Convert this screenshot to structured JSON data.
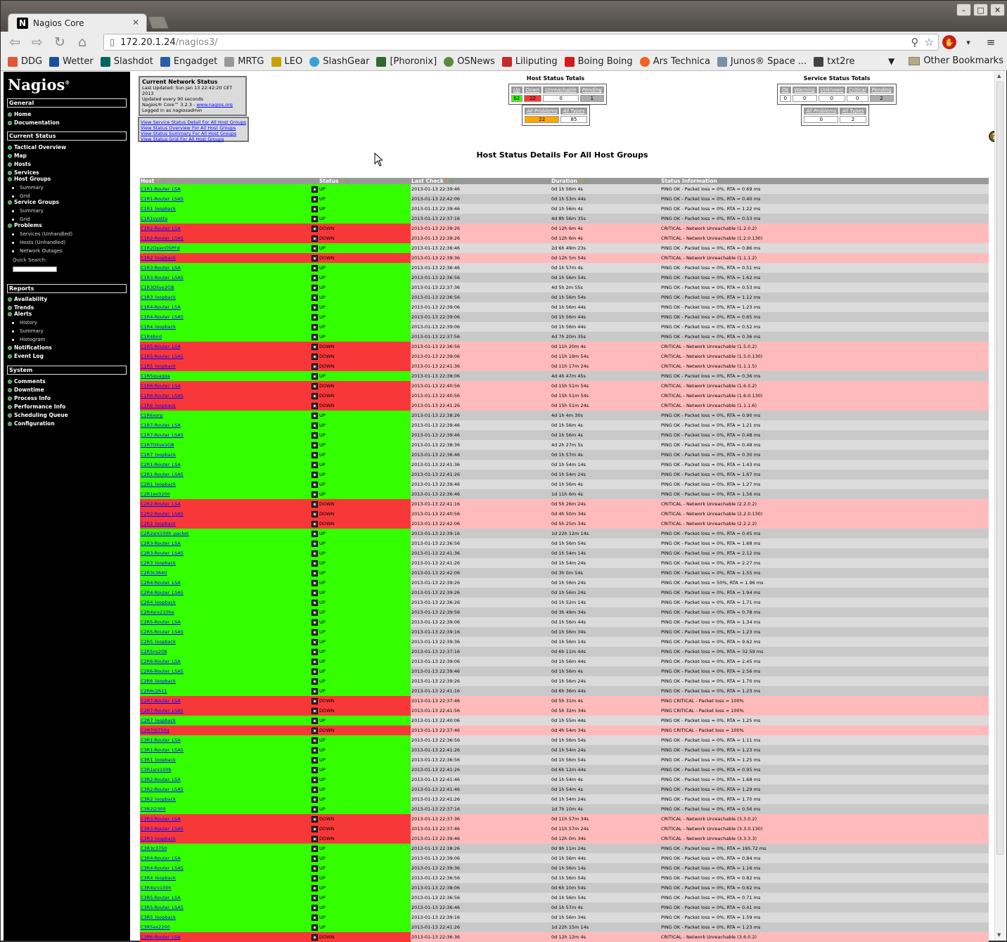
{
  "browser": {
    "tab_title": "Nagios Core",
    "url_host": "172.20.1.24",
    "url_path": "/nagios3/",
    "bookmarks": [
      "DDG",
      "Wetter",
      "Slashdot",
      "Engadget",
      "MRTG",
      "LEO",
      "SlashGear",
      "[Phoronix]",
      "OSNews",
      "Liliputing",
      "Boing Boing",
      "Ars Technica",
      "Junos® Space ...",
      "txt2re"
    ],
    "other_bookmarks": "Other Bookmarks"
  },
  "sidebar": {
    "logo": "Nagios",
    "sections": {
      "general": "General",
      "current_status": "Current Status",
      "reports": "Reports",
      "system": "System"
    },
    "general_items": [
      "Home",
      "Documentation"
    ],
    "current_items": [
      "Tactical Overview",
      "Map",
      "Hosts",
      "Services",
      "Host Groups",
      "Summary",
      "Grid",
      "Service Groups",
      "Summary",
      "Grid",
      "Problems",
      "Services (Unhandled)",
      "Hosts (Unhandled)",
      "Network Outages"
    ],
    "quick_search": "Quick Search:",
    "report_items": [
      "Availability",
      "Trends",
      "Alerts",
      "History",
      "Summary",
      "Histogram",
      "Notifications",
      "Event Log"
    ],
    "system_items": [
      "Comments",
      "Downtime",
      "Process Info",
      "Performance Info",
      "Scheduling Queue",
      "Configuration"
    ]
  },
  "status_box": {
    "title": "Current Network Status",
    "updated": "Last Updated: Sun Jan 13 22:42:20 CET 2013",
    "interval": "Updated every 90 seconds",
    "version": "Nagios® Core™ 3.2.3 - ",
    "site": "www.nagios.org",
    "logged": "Logged in as ",
    "user": "nagiosadmin",
    "links": [
      "View Service Status Detail For All Host Groups",
      "View Status Overview For All Host Groups",
      "View Status Summary For All Host Groups",
      "View Status Grid For All Host Groups"
    ]
  },
  "host_totals": {
    "title": "Host Status Totals",
    "headers": [
      "Up",
      "Down",
      "Unreachable",
      "Pending"
    ],
    "values": [
      "62",
      "22",
      "0",
      "1"
    ],
    "headers2": [
      "All Problems",
      "All Types"
    ],
    "values2": [
      "22",
      "85"
    ]
  },
  "service_totals": {
    "title": "Service Status Totals",
    "headers": [
      "Ok",
      "Warning",
      "Unknown",
      "Critical",
      "Pending"
    ],
    "values": [
      "0",
      "0",
      "0",
      "0",
      "2"
    ],
    "headers2": [
      "All Problems",
      "All Types"
    ],
    "values2": [
      "0",
      "2"
    ]
  },
  "heading": "Host Status Details For All Host Groups",
  "columns": [
    "Host",
    "Status",
    "Last Check",
    "Duration",
    "Status Information"
  ],
  "rows": [
    [
      "C1R1-Router_LSA",
      "UP",
      "2013-01-13 22:39:46",
      "0d 1h 56m 4s",
      "PING OK - Packet loss = 0%, RTA = 0.69 ms"
    ],
    [
      "C1R1-Router_LSA5",
      "UP",
      "2013-01-13 22:42:06",
      "0d 1h 53m 44s",
      "PING OK - Packet loss = 0%, RTA = 0.40 ms"
    ],
    [
      "C1R1_loopback",
      "UP",
      "2013-01-13 22:39:46",
      "0d 1h 56m 4s",
      "PING OK - Packet loss = 0%, RTA = 1.22 ms"
    ],
    [
      "C1R1vyatta",
      "UP",
      "2013-01-13 22:37:16",
      "4d 8h 56m 35s",
      "PING OK - Packet loss = 0%, RTA = 0.53 ms"
    ],
    [
      "C1R2-Router_LSA",
      "DOWN",
      "2013-01-13 22:39:26",
      "0d 12h 6m 4s",
      "CRITICAL - Network Unreachable (1.2.0.2)"
    ],
    [
      "C1R2-Router_LSA5",
      "DOWN",
      "2013-01-13 22:39:26",
      "0d 12h 6m 4s",
      "CRITICAL - Network Unreachable (1.2.0.130)"
    ],
    [
      "C1R2OpenOSPFd",
      "UP",
      "2013-01-13 22:36:46",
      "2d 6h 49m 23s",
      "PING OK - Packet loss = 0%, RTA = 0.86 ms"
    ],
    [
      "C1R2_loopback",
      "DOWN",
      "2013-01-13 22:39:36",
      "0d 12h 5m 54s",
      "CRITICAL - Network Unreachable (1.1.1.2)"
    ],
    [
      "C1R3-Router_LSA",
      "UP",
      "2013-01-13 22:36:46",
      "0d 1h 57m 4s",
      "PING OK - Packet loss = 0%, RTA = 0.51 ms"
    ],
    [
      "C1R3-Router_LSA5",
      "UP",
      "2013-01-13 22:36:56",
      "0d 1h 56m 54s",
      "PING OK - Packet loss = 0%, RTA = 1.62 ms"
    ],
    [
      "C1R3Olive2GB",
      "UP",
      "2013-01-13 22:37:36",
      "4d 5h 2m 55s",
      "PING OK - Packet loss = 0%, RTA = 0.53 ms"
    ],
    [
      "C1R3_loopback",
      "UP",
      "2013-01-13 22:36:56",
      "0d 1h 56m 54s",
      "PING OK - Packet loss = 0%, RTA = 1.12 ms"
    ],
    [
      "C1R4-Router_LSA",
      "UP",
      "2013-01-13 22:39:06",
      "0d 1h 56m 44s",
      "PING OK - Packet loss = 0%, RTA = 1.23 ms"
    ],
    [
      "C1R4-Router_LSA5",
      "UP",
      "2013-01-13 22:39:06",
      "0d 1h 56m 44s",
      "PING OK - Packet loss = 0%, RTA = 0.65 ms"
    ],
    [
      "C1R4_loopback",
      "UP",
      "2013-01-13 22:39:06",
      "0d 1h 56m 44s",
      "PING OK - Packet loss = 0%, RTA = 0.52 ms"
    ],
    [
      "C1R4bird",
      "UP",
      "2013-01-13 22:37:56",
      "4d 7h 20m 35s",
      "PING OK - Packet loss = 0%, RTA = 0.36 ms"
    ],
    [
      "C1R5-Router_LSA",
      "DOWN",
      "2013-01-13 22:36:56",
      "0d 11h 20m 4s",
      "CRITICAL - Network Unreachable (1.5.0.2)"
    ],
    [
      "C1R5-Router_LSA5",
      "DOWN",
      "2013-01-13 22:39:06",
      "0d 11h 19m 54s",
      "CRITICAL - Network Unreachable (1.5.0.130)"
    ],
    [
      "C1R5_loopback",
      "DOWN",
      "2013-01-13 22:41:36",
      "0d 11h 17m 24s",
      "CRITICAL - Network Unreachable (1.1.1.5)"
    ],
    [
      "C1R5quagga",
      "UP",
      "2013-01-13 22:38:06",
      "4d 4h 47m 45s",
      "PING OK - Packet loss = 0%, RTA = 0.36 ms"
    ],
    [
      "C1R6-Router_LSA",
      "DOWN",
      "2013-01-13 22:40:56",
      "0d 15h 51m 54s",
      "CRITICAL - Network Unreachable (1.6.0.2)"
    ],
    [
      "C1R6-Router_LSA5",
      "DOWN",
      "2013-01-13 22:40:56",
      "0d 15h 51m 54s",
      "CRITICAL - Network Unreachable (1.6.0.130)"
    ],
    [
      "C1R6_loopback",
      "DOWN",
      "2013-01-13 22:41:26",
      "0d 15h 51m 24s",
      "CRITICAL - Network Unreachable (1.1.1.6)"
    ],
    [
      "C1R6xorp",
      "UP",
      "2013-01-13 22:38:26",
      "4d 1h 4m 30s",
      "PING OK - Packet loss = 0%, RTA = 0.90 ms"
    ],
    [
      "C1R7-Router_LSA",
      "UP",
      "2013-01-13 22:39:46",
      "0d 1h 56m 4s",
      "PING OK - Packet loss = 0%, RTA = 1.21 ms"
    ],
    [
      "C1R7-Router_LSA5",
      "UP",
      "2013-01-13 22:39:46",
      "0d 1h 56m 4s",
      "PING OK - Packet loss = 0%, RTA = 0.48 ms"
    ],
    [
      "C1R7Olive1GB",
      "UP",
      "2013-01-13 22:38:36",
      "4d 2h 27m 5s",
      "PING OK - Packet loss = 0%, RTA = 0.48 ms"
    ],
    [
      "C1R7_loopback",
      "UP",
      "2013-01-13 22:36:46",
      "0d 1h 57m 4s",
      "PING OK - Packet loss = 0%, RTA = 0.30 ms"
    ],
    [
      "C2R1-Router_LSA",
      "UP",
      "2013-01-13 22:41:36",
      "0d 1h 54m 14s",
      "PING OK - Packet loss = 0%, RTA = 1.43 ms"
    ],
    [
      "C2R1-Router_LSA5",
      "UP",
      "2013-01-13 22:41:26",
      "0d 1h 54m 24s",
      "PING OK - Packet loss = 0%, RTA = 1.67 ms"
    ],
    [
      "C2R1_loopback",
      "UP",
      "2013-01-13 22:39:46",
      "0d 1h 56m 4s",
      "PING OK - Packet loss = 0%, RTA = 1.27 ms"
    ],
    [
      "C2R1ex3200",
      "UP",
      "2013-01-13 22:36:46",
      "1d 11h 6m 4s",
      "PING OK - Packet loss = 0%, RTA = 1.56 ms"
    ],
    [
      "C2R2-Router_LSA",
      "DOWN",
      "2013-01-13 22:41:16",
      "0d 5h 26m 24s",
      "CRITICAL - Network Unreachable (2.2.0.2)"
    ],
    [
      "C2R2-Router_LSA5",
      "DOWN",
      "2013-01-13 22:40:56",
      "0d 4h 50m 34s",
      "CRITICAL - Network Unreachable (2.2.0.130)"
    ],
    [
      "C2R2_loopback",
      "DOWN",
      "2013-01-13 22:42:06",
      "0d 5h 25m 34s",
      "CRITICAL - Network Unreachable (2.2.2.2)"
    ],
    [
      "C2R2srx100h_packet",
      "UP",
      "2013-01-13 22:39:16",
      "1d 22h 12m 14s",
      "PING OK - Packet loss = 0%, RTA = 0.45 ms"
    ],
    [
      "C2R3-Router_LSA",
      "UP",
      "2013-01-13 22:36:56",
      "0d 1h 56m 54s",
      "PING OK - Packet loss = 0%, RTA = 1.68 ms"
    ],
    [
      "C2R3-Router_LSA5",
      "UP",
      "2013-01-13 22:41:36",
      "0d 1h 54m 14s",
      "PING OK - Packet loss = 0%, RTA = 2.12 ms"
    ],
    [
      "C2R3_loopback",
      "UP",
      "2013-01-13 22:41:26",
      "0d 1h 54m 24s",
      "PING OK - Packet loss = 0%, RTA = 2.27 ms"
    ],
    [
      "C2R3c3640",
      "UP",
      "2013-01-13 22:42:06",
      "0d 3h 0m 54s",
      "PING OK - Packet loss = 0%, RTA = 1.55 ms"
    ],
    [
      "C2R4-Router_LSA",
      "UP",
      "2013-01-13 22:39:26",
      "0d 1h 56m 24s",
      "PING OK - Packet loss = 50%, RTA = 1.96 ms"
    ],
    [
      "C2R4-Router_LSA5",
      "UP",
      "2013-01-13 22:39:26",
      "0d 1h 56m 24s",
      "PING OK - Packet loss = 0%, RTA = 1.94 ms"
    ],
    [
      "C2R4_loopback",
      "UP",
      "2013-01-13 22:36:26",
      "0d 1h 52m 14s",
      "PING OK - Packet loss = 0%, RTA = 1.71 ms"
    ],
    [
      "C2R4srx210he",
      "UP",
      "2013-01-13 22:39:56",
      "0d 3h 49m 34s",
      "PING OK - Packet loss = 0%, RTA = 0.78 ms"
    ],
    [
      "C2R5-Router_LSA",
      "UP",
      "2013-01-13 22:39:06",
      "0d 1h 56m 44s",
      "PING OK - Packet loss = 0%, RTA = 1.34 ms"
    ],
    [
      "C2R5-Router_LSA5",
      "UP",
      "2013-01-13 22:39:16",
      "0d 1h 56m 34s",
      "PING OK - Packet loss = 0%, RTA = 1.23 ms"
    ],
    [
      "C2R5_loopback",
      "UP",
      "2013-01-13 22:39:36",
      "0d 1h 56m 14s",
      "PING OK - Packet loss = 0%, RTA = 9.62 ms"
    ],
    [
      "C2R5ns208",
      "UP",
      "2013-01-13 22:37:16",
      "0d 6h 11m 44s",
      "PING OK - Packet loss = 0%, RTA = 32.59 ms"
    ],
    [
      "C2R6-Router_LSA",
      "UP",
      "2013-01-13 22:39:06",
      "0d 1h 56m 44s",
      "PING OK - Packet loss = 0%, RTA = 2.45 ms"
    ],
    [
      "C2R6-Router_LSA5",
      "UP",
      "2013-01-13 22:39:46",
      "0d 1h 56m 4s",
      "PING OK - Packet loss = 0%, RTA = 2.56 ms"
    ],
    [
      "C2R6_loopback",
      "UP",
      "2013-01-13 22:39:26",
      "0d 1h 56m 24s",
      "PING OK - Packet loss = 0%, RTA = 1.70 ms"
    ],
    [
      "C2R6c2611",
      "UP",
      "2013-01-13 22:41:16",
      "0d 6h 36m 44s",
      "PING OK - Packet loss = 0%, RTA = 1.23 ms"
    ],
    [
      "C2R7-Router_LSA",
      "DOWN",
      "2013-01-13 22:37:46",
      "0d 5h 31m 4s",
      "PING CRITICAL - Packet loss = 100%"
    ],
    [
      "C2R7-Router_LSA5",
      "DOWN",
      "2013-01-13 22:41:56",
      "0d 5h 32m 34s",
      "PING CRITICAL - Packet loss = 100%"
    ],
    [
      "C2R7_loopback",
      "UP",
      "2013-01-13 22:40:06",
      "0d 1h 55m 44s",
      "PING OK - Packet loss = 0%, RTA = 1.25 ms"
    ],
    [
      "C2R7rb750g",
      "DOWN",
      "2013-01-13 22:37:46",
      "0d 4h 54m 34s",
      "PING CRITICAL - Packet loss = 100%"
    ],
    [
      "C3R1-Router_LSA",
      "UP",
      "2013-01-13 22:36:56",
      "0d 1h 56m 54s",
      "PING OK - Packet loss = 0%, RTA = 1.11 ms"
    ],
    [
      "C3R1-Router_LSA5",
      "UP",
      "2013-01-13 22:41:26",
      "0d 1h 54m 24s",
      "PING OK - Packet loss = 0%, RTA = 1.23 ms"
    ],
    [
      "C3R1_loopback",
      "UP",
      "2013-01-13 22:36:56",
      "0d 1h 56m 54s",
      "PING OK - Packet loss = 0%, RTA = 1.25 ms"
    ],
    [
      "C3R1srx100b",
      "UP",
      "2013-01-13 22:41:26",
      "0d 6h 12m 44s",
      "PING OK - Packet loss = 0%, RTA = 0.95 ms"
    ],
    [
      "C3R2-Router_LSA",
      "UP",
      "2013-01-13 22:41:46",
      "0d 1h 54m 4s",
      "PING OK - Packet loss = 0%, RTA = 1.68 ms"
    ],
    [
      "C3R2-Router_LSA5",
      "UP",
      "2013-01-13 22:41:46",
      "0d 1h 54m 4s",
      "PING OK - Packet loss = 0%, RTA = 1.29 ms"
    ],
    [
      "C3R2_loopback",
      "UP",
      "2013-01-13 22:41:26",
      "0d 1h 54m 24s",
      "PING OK - Packet loss = 0%, RTA = 1.70 ms"
    ],
    [
      "C3R2j2300",
      "UP",
      "2013-01-13 22:37:16",
      "1d 7h 10m 4s",
      "PING OK - Packet loss = 0%, RTA = 0.56 ms"
    ],
    [
      "C3R3-Router_LSA",
      "DOWN",
      "2013-01-13 22:37:36",
      "0d 11h 57m 34s",
      "CRITICAL - Network Unreachable (3.3.0.2)"
    ],
    [
      "C3R3-Router_LSA5",
      "DOWN",
      "2013-01-13 22:37:46",
      "0d 11h 57m 24s",
      "CRITICAL - Network Unreachable (3.3.0.130)"
    ],
    [
      "C3R3_loopback",
      "DOWN",
      "2013-01-13 22:39:46",
      "0d 12h 0m 34s",
      "CRITICAL - Network Unreachable (3.3.3.3)"
    ],
    [
      "C3R3c3750",
      "UP",
      "2013-01-13 22:38:26",
      "0d 9h 11m 24s",
      "PING OK - Packet loss = 0%, RTA = 195.72 ms"
    ],
    [
      "C3R4-Router_LSA",
      "UP",
      "2013-01-13 22:39:06",
      "0d 1h 56m 44s",
      "PING OK - Packet loss = 0%, RTA = 0.84 ms"
    ],
    [
      "C3R4-Router_LSA5",
      "UP",
      "2013-01-13 22:39:36",
      "0d 1h 56m 14s",
      "PING OK - Packet loss = 0%, RTA = 1.16 ms"
    ],
    [
      "C3R4_loopback",
      "UP",
      "2013-01-13 22:36:56",
      "0d 1h 56m 54s",
      "PING OK - Packet loss = 0%, RTA = 0.82 ms"
    ],
    [
      "C3R4srx100h",
      "UP",
      "2013-01-13 22:38:06",
      "0d 6h 10m 54s",
      "PING OK - Packet loss = 0%, RTA = 0.62 ms"
    ],
    [
      "C3R5-Router_LSA",
      "UP",
      "2013-01-13 22:36:56",
      "0d 1h 56m 54s",
      "PING OK - Packet loss = 0%, RTA = 0.71 ms"
    ],
    [
      "C3R5-Router_LSA5",
      "UP",
      "2013-01-13 22:36:46",
      "0d 1h 57m 4s",
      "PING OK - Packet loss = 0%, RTA = 0.41 ms"
    ],
    [
      "C3R5_loopback",
      "UP",
      "2013-01-13 22:39:16",
      "0d 1h 56m 34s",
      "PING OK - Packet loss = 0%, RTA = 1.59 ms"
    ],
    [
      "C3R5ex2200",
      "UP",
      "2013-01-13 22:41:26",
      "1d 22h 15m 14s",
      "PING OK - Packet loss = 0%, RTA = 1.23 ms"
    ],
    [
      "C3R6-Router_LSA",
      "DOWN",
      "2013-01-13 22:36:36",
      "0d 12h 12m 4s",
      "CRITICAL - Network Unreachable (3.6.0.2)"
    ]
  ]
}
